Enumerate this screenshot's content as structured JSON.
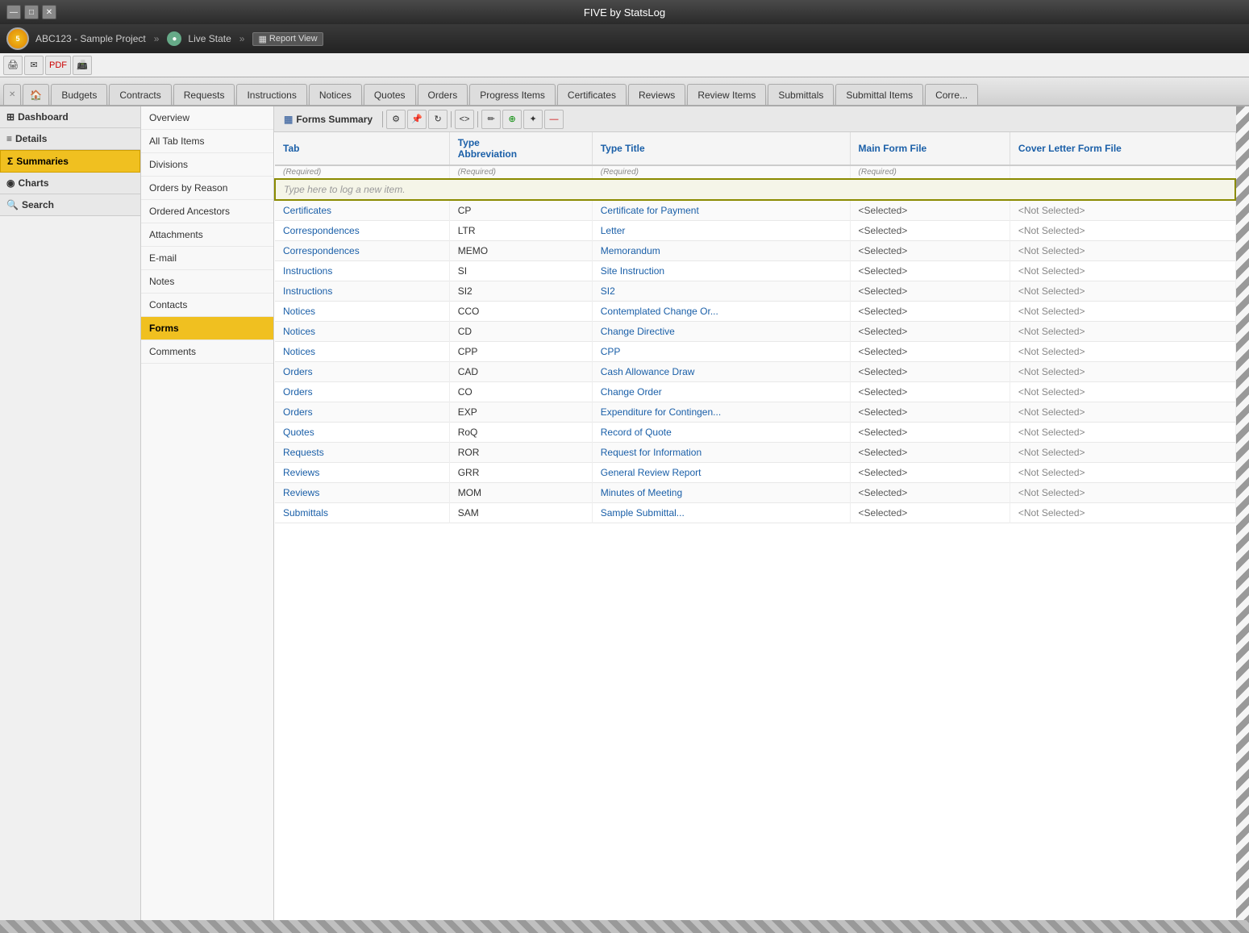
{
  "app": {
    "title": "FIVE by StatsLog",
    "project": "ABC123 - Sample Project",
    "state": "Live State",
    "view": "Report View"
  },
  "toolbar": {
    "buttons": [
      "print",
      "email",
      "pdf",
      "fax"
    ]
  },
  "tabs": [
    {
      "label": "×",
      "id": "close",
      "type": "close"
    },
    {
      "label": "🏠",
      "id": "home",
      "type": "home"
    },
    {
      "label": "Budgets",
      "id": "budgets"
    },
    {
      "label": "Contracts",
      "id": "contracts"
    },
    {
      "label": "Requests",
      "id": "requests"
    },
    {
      "label": "Instructions",
      "id": "instructions"
    },
    {
      "label": "Notices",
      "id": "notices"
    },
    {
      "label": "Quotes",
      "id": "quotes"
    },
    {
      "label": "Orders",
      "id": "orders"
    },
    {
      "label": "Progress Items",
      "id": "progress-items"
    },
    {
      "label": "Certificates",
      "id": "certificates"
    },
    {
      "label": "Reviews",
      "id": "reviews"
    },
    {
      "label": "Review Items",
      "id": "review-items"
    },
    {
      "label": "Submittals",
      "id": "submittals"
    },
    {
      "label": "Submittal Items",
      "id": "submittal-items"
    },
    {
      "label": "Corre...",
      "id": "corre"
    }
  ],
  "sidebar": {
    "sections": [
      {
        "id": "dashboard",
        "label": "Dashboard",
        "icon": "⊞",
        "type": "header"
      },
      {
        "id": "details",
        "label": "Details",
        "icon": "≡",
        "type": "header"
      },
      {
        "id": "summaries",
        "label": "Summaries",
        "icon": "Σ",
        "type": "header",
        "active": true
      },
      {
        "id": "charts",
        "label": "Charts",
        "icon": "◉",
        "type": "header"
      },
      {
        "id": "search",
        "label": "Search",
        "icon": "🔍",
        "type": "header"
      }
    ]
  },
  "sub_nav": {
    "items": [
      {
        "label": "Overview",
        "id": "overview"
      },
      {
        "label": "All Tab Items",
        "id": "all-tab-items"
      },
      {
        "label": "Divisions",
        "id": "divisions"
      },
      {
        "label": "Orders by Reason",
        "id": "orders-by-reason"
      },
      {
        "label": "Ordered Ancestors",
        "id": "ordered-ancestors"
      },
      {
        "label": "Attachments",
        "id": "attachments"
      },
      {
        "label": "E-mail",
        "id": "email"
      },
      {
        "label": "Notes",
        "id": "notes"
      },
      {
        "label": "Contacts",
        "id": "contacts"
      },
      {
        "label": "Forms",
        "id": "forms",
        "active": true
      },
      {
        "label": "Comments",
        "id": "comments"
      }
    ]
  },
  "forms_panel": {
    "title": "Forms Summary",
    "toolbar_buttons": [
      "settings",
      "pin",
      "refresh",
      "code",
      "edit",
      "add-green",
      "wand",
      "delete"
    ]
  },
  "table": {
    "columns": [
      {
        "id": "tab",
        "label": "Tab"
      },
      {
        "id": "type_abbr",
        "label": "Type Abbreviation"
      },
      {
        "id": "type_title",
        "label": "Type Title"
      },
      {
        "id": "main_form_file",
        "label": "Main Form File"
      },
      {
        "id": "cover_letter_form_file",
        "label": "Cover Letter Form File"
      }
    ],
    "required_labels": [
      "(Required)",
      "(Required)",
      "(Required)",
      "(Required)",
      ""
    ],
    "new_item_placeholder": "Type here to log a new item.",
    "rows": [
      {
        "tab": "Certificates",
        "type_abbr": "CP",
        "type_title": "Certificate for Payment",
        "main_form_file": "<Selected>",
        "cover_letter_form_file": "<Not Selected>"
      },
      {
        "tab": "Correspondences",
        "type_abbr": "LTR",
        "type_title": "Letter",
        "main_form_file": "<Selected>",
        "cover_letter_form_file": "<Not Selected>"
      },
      {
        "tab": "Correspondences",
        "type_abbr": "MEMO",
        "type_title": "Memorandum",
        "main_form_file": "<Selected>",
        "cover_letter_form_file": "<Not Selected>"
      },
      {
        "tab": "Instructions",
        "type_abbr": "SI",
        "type_title": "Site Instruction",
        "main_form_file": "<Selected>",
        "cover_letter_form_file": "<Not Selected>"
      },
      {
        "tab": "Instructions",
        "type_abbr": "SI2",
        "type_title": "SI2",
        "main_form_file": "<Selected>",
        "cover_letter_form_file": "<Not Selected>"
      },
      {
        "tab": "Notices",
        "type_abbr": "CCO",
        "type_title": "Contemplated Change Or...",
        "main_form_file": "<Selected>",
        "cover_letter_form_file": "<Not Selected>"
      },
      {
        "tab": "Notices",
        "type_abbr": "CD",
        "type_title": "Change Directive",
        "main_form_file": "<Selected>",
        "cover_letter_form_file": "<Not Selected>"
      },
      {
        "tab": "Notices",
        "type_abbr": "CPP",
        "type_title": "CPP",
        "main_form_file": "<Selected>",
        "cover_letter_form_file": "<Not Selected>"
      },
      {
        "tab": "Orders",
        "type_abbr": "CAD",
        "type_title": "Cash Allowance Draw",
        "main_form_file": "<Selected>",
        "cover_letter_form_file": "<Not Selected>"
      },
      {
        "tab": "Orders",
        "type_abbr": "CO",
        "type_title": "Change Order",
        "main_form_file": "<Selected>",
        "cover_letter_form_file": "<Not Selected>"
      },
      {
        "tab": "Orders",
        "type_abbr": "EXP",
        "type_title": "Expenditure for Contingen...",
        "main_form_file": "<Selected>",
        "cover_letter_form_file": "<Not Selected>"
      },
      {
        "tab": "Quotes",
        "type_abbr": "RoQ",
        "type_title": "Record of Quote",
        "main_form_file": "<Selected>",
        "cover_letter_form_file": "<Not Selected>"
      },
      {
        "tab": "Requests",
        "type_abbr": "ROR",
        "type_title": "Request for Information",
        "main_form_file": "<Selected>",
        "cover_letter_form_file": "<Not Selected>"
      },
      {
        "tab": "Reviews",
        "type_abbr": "GRR",
        "type_title": "General Review Report",
        "main_form_file": "<Selected>",
        "cover_letter_form_file": "<Not Selected>"
      },
      {
        "tab": "Reviews",
        "type_abbr": "MOM",
        "type_title": "Minutes of Meeting",
        "main_form_file": "<Selected>",
        "cover_letter_form_file": "<Not Selected>"
      },
      {
        "tab": "Submittals",
        "type_abbr": "SAM",
        "type_title": "Sample Submittal...",
        "main_form_file": "<Selected>",
        "cover_letter_form_file": "<Not Selected>"
      }
    ]
  }
}
